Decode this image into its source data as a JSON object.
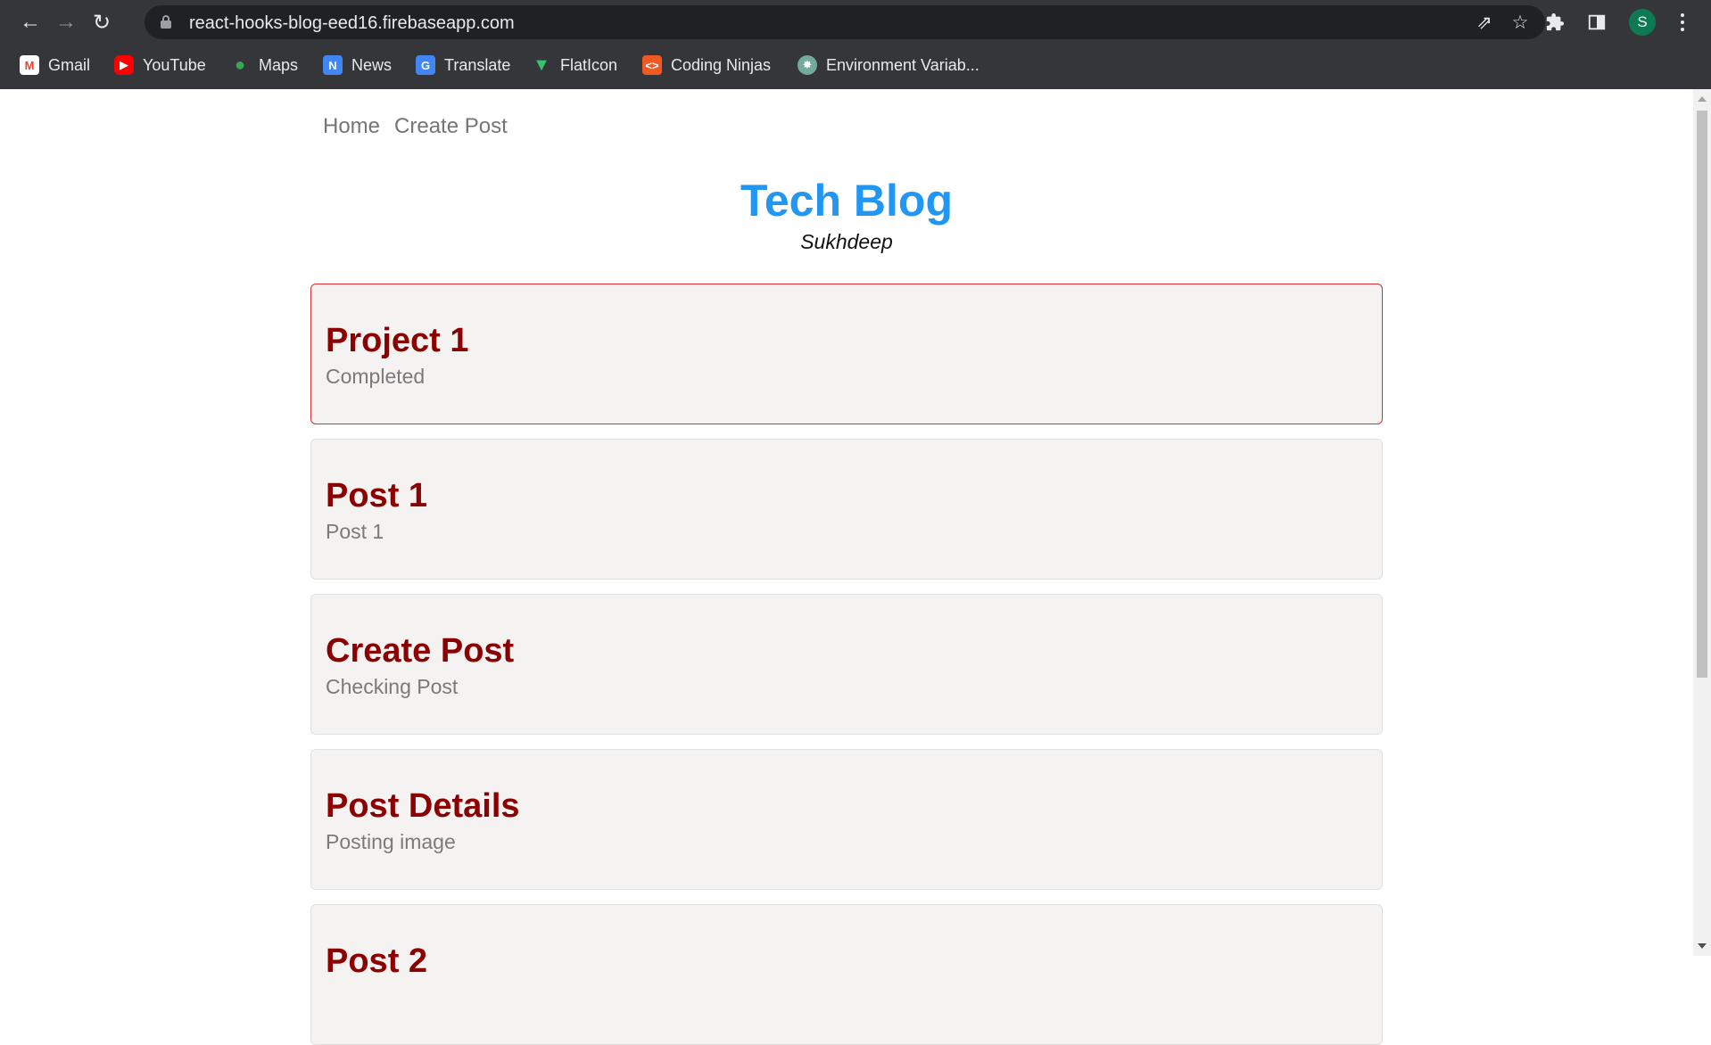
{
  "browser": {
    "url": "react-hooks-blog-eed16.firebaseapp.com",
    "profile_initial": "S",
    "bookmarks": [
      {
        "label": "Gmail",
        "icon": "gmail-icon",
        "color": "#ea4335"
      },
      {
        "label": "YouTube",
        "icon": "youtube-icon",
        "color": "#ff0000"
      },
      {
        "label": "Maps",
        "icon": "maps-icon",
        "color": "#34a853"
      },
      {
        "label": "News",
        "icon": "news-icon",
        "color": "#4285f4"
      },
      {
        "label": "Translate",
        "icon": "translate-icon",
        "color": "#4285f4"
      },
      {
        "label": "FlatIcon",
        "icon": "flaticon-icon",
        "color": "#35c16d"
      },
      {
        "label": "Coding Ninjas",
        "icon": "coding-ninjas-icon",
        "color": "#f05a22"
      },
      {
        "label": "Environment Variab...",
        "icon": "openai-icon",
        "color": "#74aa9c"
      }
    ]
  },
  "nav": {
    "home": "Home",
    "create_post": "Create Post"
  },
  "blog": {
    "title": "Tech Blog",
    "author": "Sukhdeep"
  },
  "posts": [
    {
      "title": "Project 1",
      "subtitle": "Completed"
    },
    {
      "title": "Post 1",
      "subtitle": "Post 1"
    },
    {
      "title": "Create Post",
      "subtitle": "Checking Post"
    },
    {
      "title": "Post Details",
      "subtitle": "Posting image"
    },
    {
      "title": "Post 2",
      "subtitle": ""
    }
  ]
}
